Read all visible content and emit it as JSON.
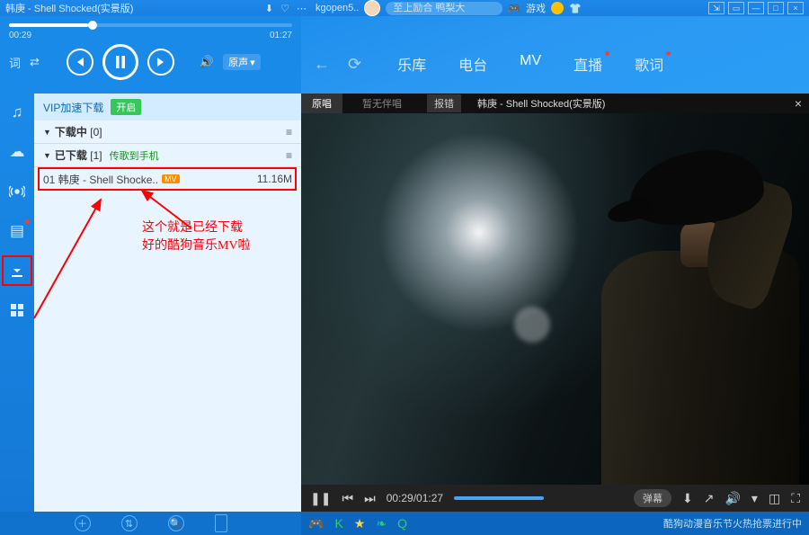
{
  "topbar": {
    "now_playing": "韩庚 - Shell Shocked(实景版)",
    "kgopen": "kgopen5..",
    "search_placeholder": "至上励合 鸭梨大",
    "game_label": "游戏"
  },
  "player": {
    "cur_time": "00:29",
    "total_time": "01:27",
    "sound_label": "原声"
  },
  "nav": {
    "tabs": [
      "乐库",
      "电台",
      "MV",
      "直播",
      "歌词"
    ],
    "active": 2
  },
  "sidebar": {
    "items": [
      {
        "name": "music-icon",
        "glyph": "♫"
      },
      {
        "name": "cloud-icon",
        "glyph": "☁"
      },
      {
        "name": "radio-icon",
        "glyph": "⊚"
      },
      {
        "name": "calendar-icon",
        "glyph": "▤",
        "dot": true
      },
      {
        "name": "download-icon",
        "glyph": "⬇",
        "highlight": true
      },
      {
        "name": "apps-icon",
        "glyph": "⠿"
      }
    ]
  },
  "dl": {
    "vip_label": "VIP加速下载",
    "on_badge": "开启",
    "downloading": {
      "label": "下载中",
      "count": "[0]"
    },
    "downloaded": {
      "label": "已下载",
      "count": "[1]",
      "aux": "传歌到手机"
    },
    "file": {
      "name": "01 韩庚 - Shell Shocke..",
      "size": "11.16M"
    },
    "annotation": "这个就是已经下载\n好的酷狗音乐MV啦"
  },
  "video": {
    "tab_original": "原唱",
    "tab_noacc": "暂无伴唱",
    "report": "报错",
    "title": "韩庚 - Shell Shocked(实景版)",
    "time": "00:29/01:27",
    "danmu": "弹幕"
  },
  "bottom": {
    "ticker": "酷狗动漫音乐节火热抢票进行中"
  }
}
